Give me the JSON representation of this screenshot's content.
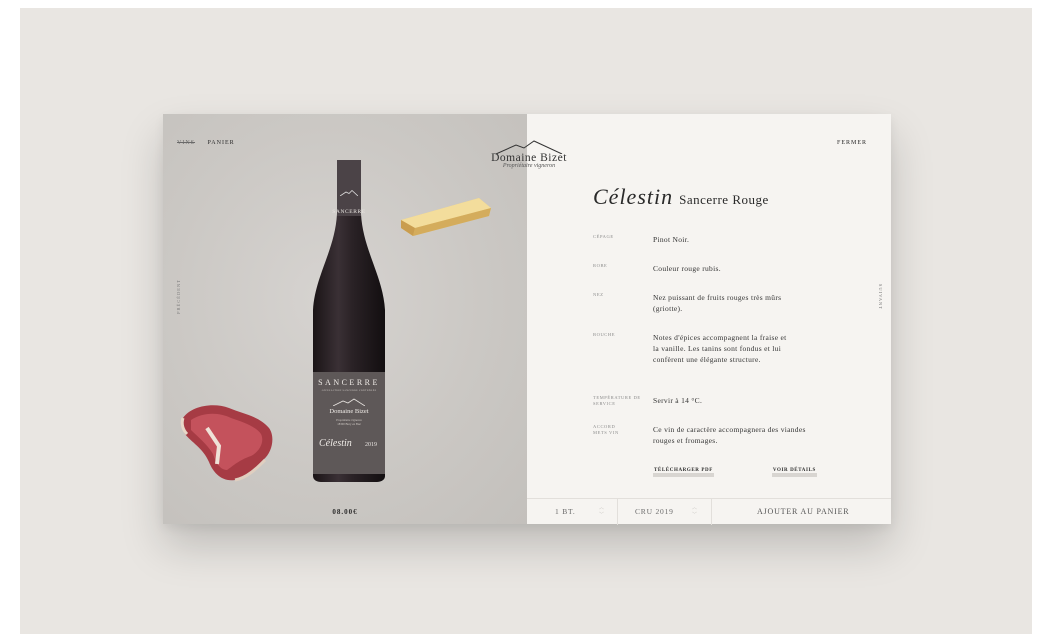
{
  "nav": {
    "wines": "VINS",
    "cart": "PANIER",
    "close": "FERMER"
  },
  "side": {
    "previous": "PRÉCÉDENT",
    "next": "SUIVANT"
  },
  "brand": {
    "name": "Domaine Bizet",
    "tagline": "Propriétaire vigneron"
  },
  "bottle_label": {
    "appellation": "SANCERRE",
    "appellation_sub": "APPELLATION SANCERRE CONTRÔLÉE",
    "domain": "Domaine Bizet",
    "lines": [
      "Propriétaire vigneron",
      "18300 Bury en Bué"
    ],
    "wine": "Célestin",
    "year": "2019",
    "capsule": "SANCERRE"
  },
  "price": "08.00€",
  "product": {
    "name": "Célestin",
    "appellation": "Sancerre Rouge"
  },
  "specs": [
    {
      "label": "CÉPAGE",
      "value": "Pinot Noir."
    },
    {
      "label": "ROBE",
      "value": "Couleur rouge rubis."
    },
    {
      "label": "NEZ",
      "value": "Nez puissant de fruits rouges très mûrs (griotte)."
    },
    {
      "label": "BOUCHE",
      "value": "Notes d'épices accompagnent la fraise et la vanille. Les tanins sont fondus et lui confèrent une élégante structure."
    },
    {
      "label": "TEMPÉRATURE DE SERVICE",
      "value": "Servir à 14 °C."
    },
    {
      "label": "ACCORD METS VIN",
      "value": "Ce vin de caractère accompagnera des viandes rouges et fromages."
    }
  ],
  "links": {
    "pdf": "TÉLÉCHARGER PDF",
    "details": "VOIR DÉTAILS"
  },
  "bottom": {
    "quantity": "1 BT.",
    "vintage": "CRU 2019",
    "add_to_cart": "AJOUTER AU PANIER"
  },
  "colors": {
    "left_bg": "#cbc8c4",
    "right_bg": "#f6f4f1",
    "bottle": "#2b2426",
    "label": "#5e5858"
  }
}
